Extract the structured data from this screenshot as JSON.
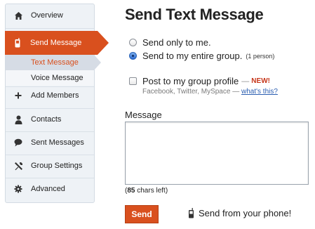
{
  "sidebar": {
    "items": [
      {
        "label": "Overview",
        "icon": "home-icon"
      },
      {
        "label": "Send Message",
        "icon": "phone-icon",
        "active": true
      },
      {
        "label": "Add Members",
        "icon": "plus-icon"
      },
      {
        "label": "Contacts",
        "icon": "person-icon"
      },
      {
        "label": "Sent Messages",
        "icon": "speech-bubble-icon"
      },
      {
        "label": "Group Settings",
        "icon": "tools-icon"
      },
      {
        "label": "Advanced",
        "icon": "gear-icon"
      }
    ],
    "subitems": [
      {
        "label": "Text Message",
        "active": true
      },
      {
        "label": "Voice Message"
      }
    ]
  },
  "main": {
    "title": "Send Text Message",
    "recipients": [
      {
        "label": "Send only to me.",
        "checked": false,
        "note": ""
      },
      {
        "label": "Send to my entire group.",
        "checked": true,
        "note": "(1 person)"
      }
    ],
    "post_profile": {
      "label": "Post to my group profile",
      "dash": "—",
      "badge": "NEW!",
      "sites": "Facebook, Twitter, MySpace —",
      "help_link": "what's this?"
    },
    "message_label": "Message",
    "chars_left_prefix": "(",
    "chars_left_count": "85",
    "chars_left_suffix": " chars left)",
    "send_button": "Send",
    "phone_link": "Send from your phone!"
  },
  "colors": {
    "accent": "#d9501e",
    "sidebar_bg": "#eef2f6",
    "link": "#2a5db0",
    "new_badge": "#c6361a"
  }
}
